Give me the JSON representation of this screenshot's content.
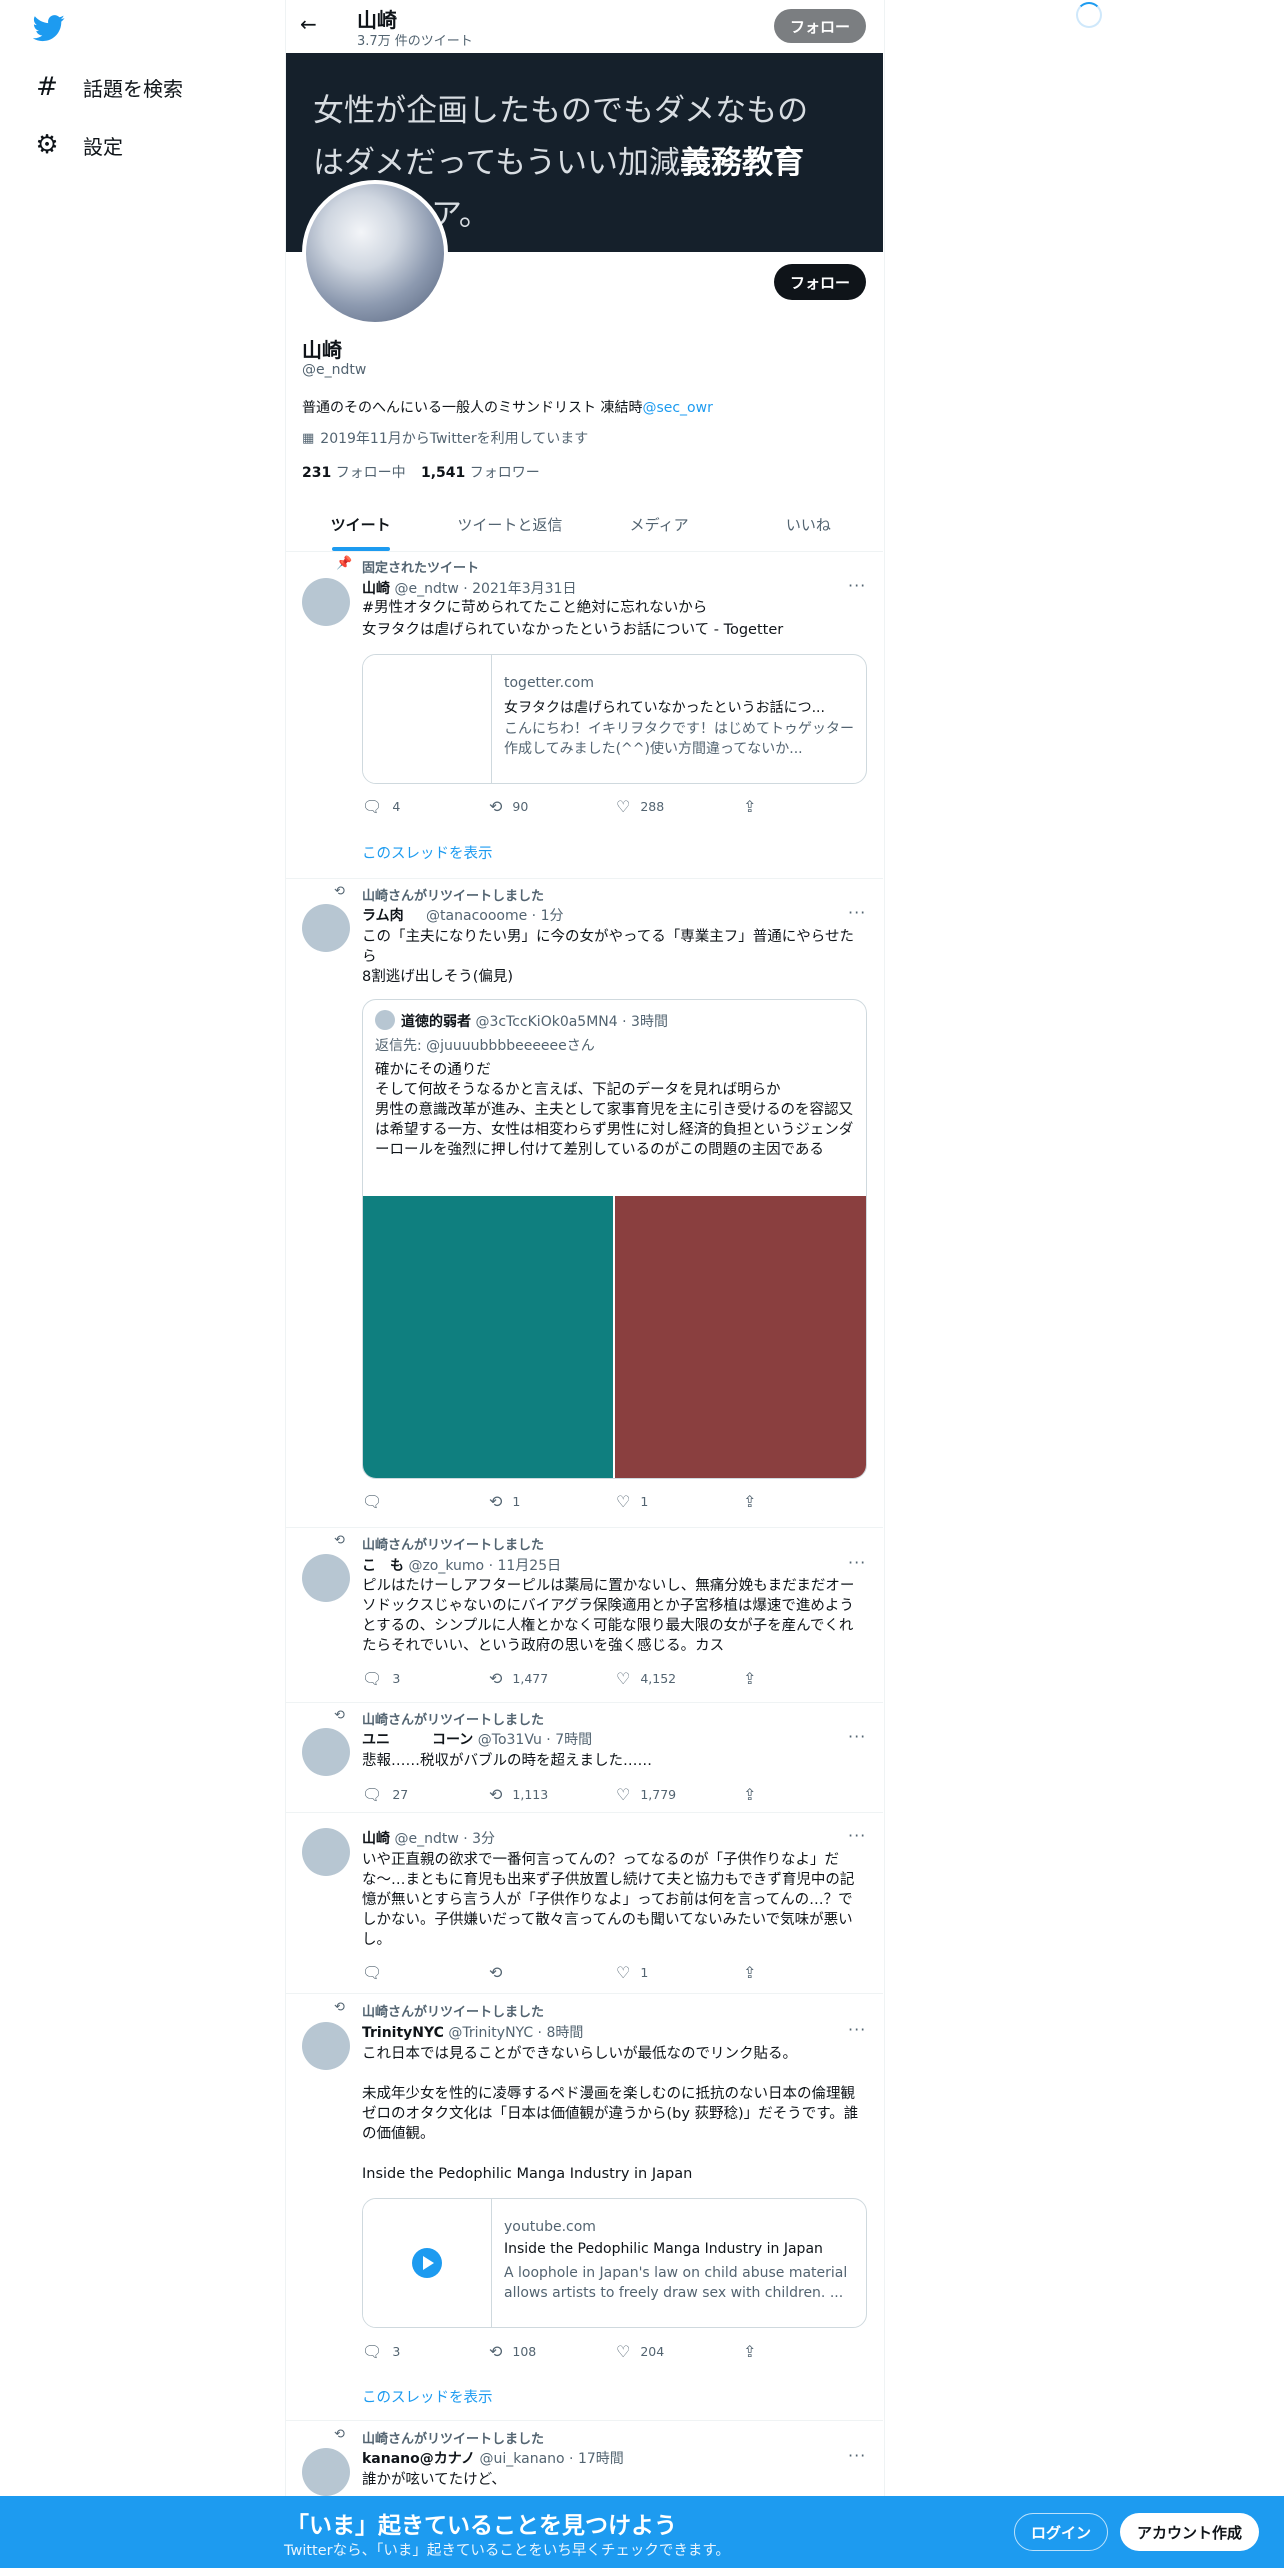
{
  "sidebar": {
    "items": [
      {
        "label": "話題を検索",
        "icon": "hashtag-icon"
      },
      {
        "label": "設定",
        "icon": "gear-icon"
      }
    ]
  },
  "header": {
    "name": "山崎",
    "tweet_count": "3.7万 件のツイート",
    "follow_label": "フォロー"
  },
  "banner": {
    "line1": "女性が企画したものでもダメなもの",
    "line2_a": "はダメだってもういい加減",
    "line2_b": "義務教育",
    "line3": "ア。"
  },
  "profile": {
    "follow_label": "フォロー",
    "name": "山崎",
    "handle": "@e_ndtw",
    "bio": "普通のそのへんにいる一般人のミサンドリスト 凍結時",
    "bio_link": "@sec_owr",
    "joined": "2019年11月からTwitterを利用しています",
    "following_count": "231",
    "following_label": "フォロー中",
    "followers_count": "1,541",
    "followers_label": "フォロワー"
  },
  "tabs": [
    "ツイート",
    "ツイートと返信",
    "メディア",
    "いいね"
  ],
  "tweet1": {
    "pinned": "固定されたツイート",
    "name": "山崎",
    "handle": "@e_ndtw",
    "date": "2021年3月31日",
    "hashtag": "#男性オタクに苛められてたこと絶対に忘れないから",
    "text": "女ヲタクは虐げられていなかったというお話について - Togetter",
    "card_domain": "togetter.com",
    "card_title": "女ヲタクは虐げられていなかったというお話につ...",
    "card_desc": "こんにちわ！イキリヲタクです！はじめてトゥゲッター作成してみました(^^)使い方間違ってないか...",
    "replies": "4",
    "retweets": "90",
    "likes": "288",
    "thread": "このスレッドを表示"
  },
  "tweet2": {
    "rt_label": "山崎さんがリツイートしました",
    "name": "ラム肉",
    "handle": "@tanacooome",
    "time": "1分",
    "text": "この「主夫になりたい男」に今の女がやってる「専業主フ」普通にやらせたら\n8割逃げ出しそう(偏見)",
    "quote_name": "道徳的弱者",
    "quote_handle": "@3cTccKiOk0a5MN4",
    "quote_time": "3時間",
    "quote_reply": "返信先: @juuuubbbbeeeeeeさん",
    "quote_text": "確かにその通りだ\nそして何故そうなるかと言えば、下記のデータを見れば明らか\n男性の意識改革が進み、主夫として家事育児を主に引き受けるのを容認又は希望する一方、女性は相変わらず男性に対し経済的負担というジェンダーロールを強烈に押し付けて差別しているのがこの問題の主因である",
    "img_left_color": "#0f7f7f",
    "img_right_color": "#8a3f3f",
    "replies": "",
    "retweets": "1",
    "likes": "1"
  },
  "tweet3": {
    "rt_label": "山崎さんがリツイートしました",
    "name": "こ　も",
    "handle": "@zo_kumo",
    "time": "11月25日",
    "text": "ピルはたけーしアフターピルは薬局に置かないし、無痛分娩もまだまだオーソドックスじゃないのにバイアグラ保険適用とか子宮移植は爆速で進めようとするの、シンプルに人権とかなく可能な限り最大限の女が子を産んでくれたらそれでいい、という政府の思いを強く感じる。カス",
    "replies": "3",
    "retweets": "1,477",
    "likes": "4,152"
  },
  "tweet4": {
    "rt_label": "山崎さんがリツイートしました",
    "name": "ユニ　　　コーン",
    "handle": "@To31Vu",
    "time": "7時間",
    "text": "悲報……税収がバブルの時を超えました……",
    "replies": "27",
    "retweets": "1,113",
    "likes": "1,779"
  },
  "tweet5": {
    "name": "山崎",
    "handle": "@e_ndtw",
    "time": "3分",
    "text": "いや正直親の欲求で一番何言ってんの？ってなるのが「子供作りなよ」だな〜…まともに育児も出来ず子供放置し続けて夫と協力もできず育児中の記憶が無いとすら言う人が「子供作りなよ」ってお前は何を言ってんの…？でしかない。子供嫌いだって散々言ってんのも聞いてないみたいで気味が悪いし。",
    "replies": "",
    "retweets": "",
    "likes": "1"
  },
  "tweet6": {
    "rt_label": "山崎さんがリツイートしました",
    "name": "TrinityNYC",
    "handle": "@TrinityNYC",
    "time": "8時間",
    "text": "これ日本では見ることができないらしいが最低なのでリンク貼る。\n\n未成年少女を性的に凌辱するペド漫画を楽しむのに抵抗のない日本の倫理観ゼロのオタク文化は「日本は価値観が違うから(by 荻野稔)」だそうです。誰の価値観。\n\nInside the Pedophilic Manga Industry in Japan",
    "card_domain": "youtube.com",
    "card_title": "Inside the Pedophilic Manga Industry in Japan",
    "card_desc": "A loophole in Japan's law on child abuse material allows artists to freely draw sex with children. ...",
    "replies": "3",
    "retweets": "108",
    "likes": "204",
    "thread": "このスレッドを表示"
  },
  "tweet7": {
    "rt_label": "山崎さんがリツイートしました",
    "name": "kanano@カナノ",
    "handle": "@ui_kanano",
    "time": "17時間",
    "text": "誰かが呟いてたけど、"
  },
  "bottom_bar": {
    "title": "「いま」起きていることを見つけよう",
    "subtitle": "Twitterなら、「いま」起きていることをいち早くチェックできます。",
    "login": "ログイン",
    "signup": "アカウント作成"
  },
  "colors": {
    "accent": "#1d9bf0",
    "banner_bg": "#15202b",
    "text": "#0f1419",
    "muted": "#536471"
  }
}
